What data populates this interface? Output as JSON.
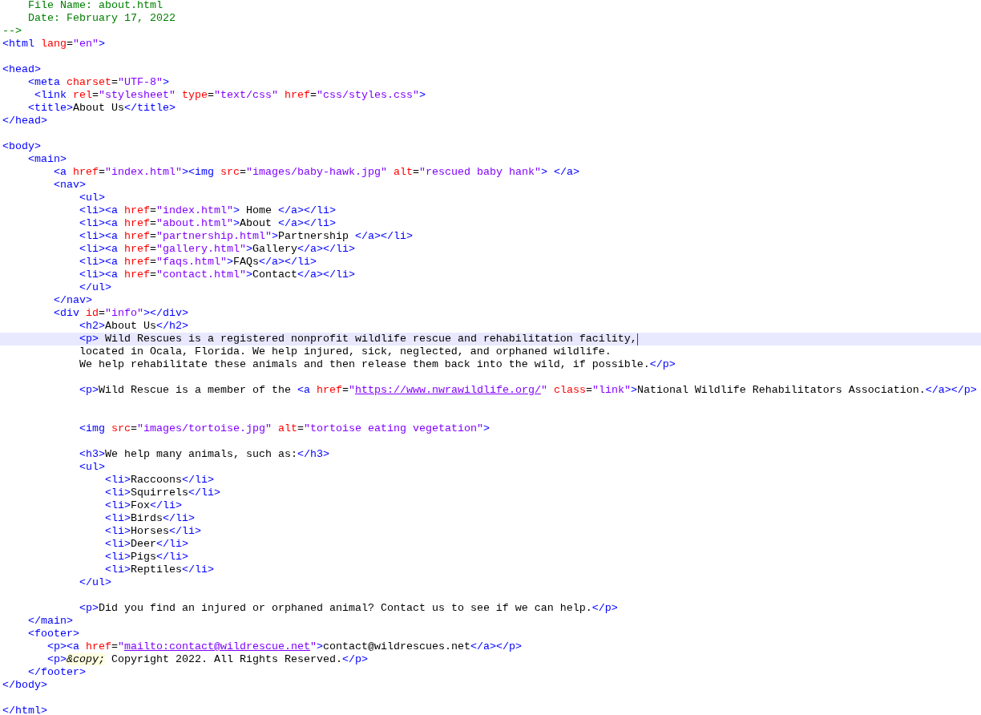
{
  "editor": {
    "lines": [
      {
        "kind": "code",
        "selected": false,
        "tokens": [
          {
            "kind": "comment",
            "text": "    File Name: about.html"
          }
        ]
      },
      {
        "kind": "code",
        "selected": false,
        "tokens": [
          {
            "kind": "comment",
            "text": "    Date: February 17, 2022"
          }
        ]
      },
      {
        "kind": "code",
        "selected": false,
        "tokens": [
          {
            "kind": "comment",
            "text": "-->"
          }
        ]
      },
      {
        "kind": "code",
        "selected": false,
        "tokens": [
          {
            "kind": "tag",
            "text": "<html "
          },
          {
            "kind": "attr",
            "text": "lang"
          },
          {
            "kind": "text",
            "text": "="
          },
          {
            "kind": "value",
            "text": "\"en\""
          },
          {
            "kind": "tag",
            "text": ">"
          }
        ]
      },
      {
        "kind": "blank"
      },
      {
        "kind": "code",
        "selected": false,
        "tokens": [
          {
            "kind": "tag",
            "text": "<head>"
          }
        ]
      },
      {
        "kind": "code",
        "selected": false,
        "tokens": [
          {
            "kind": "tag",
            "text": "    <meta "
          },
          {
            "kind": "attr",
            "text": "charset"
          },
          {
            "kind": "text",
            "text": "="
          },
          {
            "kind": "value",
            "text": "\"UTF-8\""
          },
          {
            "kind": "tag",
            "text": ">"
          }
        ]
      },
      {
        "kind": "code",
        "selected": false,
        "tokens": [
          {
            "kind": "tag",
            "text": "     <link "
          },
          {
            "kind": "attr",
            "text": "rel"
          },
          {
            "kind": "text",
            "text": "="
          },
          {
            "kind": "value",
            "text": "\"stylesheet\" "
          },
          {
            "kind": "attr",
            "text": "type"
          },
          {
            "kind": "text",
            "text": "="
          },
          {
            "kind": "value",
            "text": "\"text/css\" "
          },
          {
            "kind": "attr",
            "text": "href"
          },
          {
            "kind": "text",
            "text": "="
          },
          {
            "kind": "value",
            "text": "\"css/styles.css\""
          },
          {
            "kind": "tag",
            "text": ">"
          }
        ]
      },
      {
        "kind": "code",
        "selected": false,
        "tokens": [
          {
            "kind": "tag",
            "text": "    <title>"
          },
          {
            "kind": "text",
            "text": "About Us"
          },
          {
            "kind": "tag",
            "text": "</title>"
          }
        ]
      },
      {
        "kind": "code",
        "selected": false,
        "tokens": [
          {
            "kind": "tag",
            "text": "</head>"
          }
        ]
      },
      {
        "kind": "blank"
      },
      {
        "kind": "code",
        "selected": false,
        "tokens": [
          {
            "kind": "tag",
            "text": "<body>"
          }
        ]
      },
      {
        "kind": "code",
        "selected": false,
        "tokens": [
          {
            "kind": "tag",
            "text": "    <main>"
          }
        ]
      },
      {
        "kind": "code",
        "selected": false,
        "tokens": [
          {
            "kind": "tag",
            "text": "        <a "
          },
          {
            "kind": "attr",
            "text": "href"
          },
          {
            "kind": "text",
            "text": "="
          },
          {
            "kind": "value",
            "text": "\"index.html\""
          },
          {
            "kind": "tag",
            "text": "><img "
          },
          {
            "kind": "attr",
            "text": "src"
          },
          {
            "kind": "text",
            "text": "="
          },
          {
            "kind": "value",
            "text": "\"images/baby-hawk.jpg\" "
          },
          {
            "kind": "attr",
            "text": "alt"
          },
          {
            "kind": "text",
            "text": "="
          },
          {
            "kind": "value",
            "text": "\"rescued baby hank\""
          },
          {
            "kind": "tag",
            "text": "> </a>"
          }
        ]
      },
      {
        "kind": "code",
        "selected": false,
        "tokens": [
          {
            "kind": "tag",
            "text": "        <nav>"
          }
        ]
      },
      {
        "kind": "code",
        "selected": false,
        "tokens": [
          {
            "kind": "tag",
            "text": "            <ul>"
          }
        ]
      },
      {
        "kind": "code",
        "selected": false,
        "tokens": [
          {
            "kind": "tag",
            "text": "            <li><a "
          },
          {
            "kind": "attr",
            "text": "href"
          },
          {
            "kind": "text",
            "text": "="
          },
          {
            "kind": "value",
            "text": "\"index.html\""
          },
          {
            "kind": "tag",
            "text": ">"
          },
          {
            "kind": "text",
            "text": " Home "
          },
          {
            "kind": "tag",
            "text": "</a></li>"
          }
        ]
      },
      {
        "kind": "code",
        "selected": false,
        "tokens": [
          {
            "kind": "tag",
            "text": "            <li><a "
          },
          {
            "kind": "attr",
            "text": "href"
          },
          {
            "kind": "text",
            "text": "="
          },
          {
            "kind": "value",
            "text": "\"about.html\""
          },
          {
            "kind": "tag",
            "text": ">"
          },
          {
            "kind": "text",
            "text": "About "
          },
          {
            "kind": "tag",
            "text": "</a></li>"
          }
        ]
      },
      {
        "kind": "code",
        "selected": false,
        "tokens": [
          {
            "kind": "tag",
            "text": "            <li><a "
          },
          {
            "kind": "attr",
            "text": "href"
          },
          {
            "kind": "text",
            "text": "="
          },
          {
            "kind": "value",
            "text": "\"partnership.html\""
          },
          {
            "kind": "tag",
            "text": ">"
          },
          {
            "kind": "text",
            "text": "Partnership "
          },
          {
            "kind": "tag",
            "text": "</a></li>"
          }
        ]
      },
      {
        "kind": "code",
        "selected": false,
        "tokens": [
          {
            "kind": "tag",
            "text": "            <li><a "
          },
          {
            "kind": "attr",
            "text": "href"
          },
          {
            "kind": "text",
            "text": "="
          },
          {
            "kind": "value",
            "text": "\"gallery.html\""
          },
          {
            "kind": "tag",
            "text": ">"
          },
          {
            "kind": "text",
            "text": "Gallery"
          },
          {
            "kind": "tag",
            "text": "</a></li>"
          }
        ]
      },
      {
        "kind": "code",
        "selected": false,
        "tokens": [
          {
            "kind": "tag",
            "text": "            <li><a "
          },
          {
            "kind": "attr",
            "text": "href"
          },
          {
            "kind": "text",
            "text": "="
          },
          {
            "kind": "value",
            "text": "\"faqs.html\""
          },
          {
            "kind": "tag",
            "text": ">"
          },
          {
            "kind": "text",
            "text": "FAQs"
          },
          {
            "kind": "tag",
            "text": "</a></li>"
          }
        ]
      },
      {
        "kind": "code",
        "selected": false,
        "tokens": [
          {
            "kind": "tag",
            "text": "            <li><a "
          },
          {
            "kind": "attr",
            "text": "href"
          },
          {
            "kind": "text",
            "text": "="
          },
          {
            "kind": "value",
            "text": "\"contact.html\""
          },
          {
            "kind": "tag",
            "text": ">"
          },
          {
            "kind": "text",
            "text": "Contact"
          },
          {
            "kind": "tag",
            "text": "</a></li>"
          }
        ]
      },
      {
        "kind": "code",
        "selected": false,
        "tokens": [
          {
            "kind": "tag",
            "text": "            </ul>"
          }
        ]
      },
      {
        "kind": "code",
        "selected": false,
        "tokens": [
          {
            "kind": "tag",
            "text": "        </nav>"
          }
        ]
      },
      {
        "kind": "code",
        "selected": false,
        "tokens": [
          {
            "kind": "tag",
            "text": "        <div "
          },
          {
            "kind": "attr",
            "text": "id"
          },
          {
            "kind": "text",
            "text": "="
          },
          {
            "kind": "value",
            "text": "\"info\""
          },
          {
            "kind": "tag",
            "text": "></div>"
          }
        ]
      },
      {
        "kind": "code",
        "selected": false,
        "tokens": [
          {
            "kind": "tag",
            "text": "            <h2>"
          },
          {
            "kind": "text",
            "text": "About Us"
          },
          {
            "kind": "tag",
            "text": "</h2>"
          }
        ]
      },
      {
        "kind": "code",
        "selected": true,
        "tokens": [
          {
            "kind": "tag",
            "text": "            <p>"
          },
          {
            "kind": "text",
            "text": " Wild Rescues is a registered nonprofit wildlife rescue and rehabilitation facility,"
          }
        ]
      },
      {
        "kind": "code",
        "selected": false,
        "tokens": [
          {
            "kind": "text",
            "text": "            located in Ocala, Florida. We help injured, sick, neglected, and orphaned wildlife."
          }
        ]
      },
      {
        "kind": "code",
        "selected": false,
        "tokens": [
          {
            "kind": "text",
            "text": "            We help rehabilitate these animals and then release them back into the wild, if possible."
          },
          {
            "kind": "tag",
            "text": "</p>"
          }
        ]
      },
      {
        "kind": "blank"
      },
      {
        "kind": "code",
        "selected": false,
        "tokens": [
          {
            "kind": "tag",
            "text": "            <p>"
          },
          {
            "kind": "text",
            "text": "Wild Rescue is a member of the "
          },
          {
            "kind": "tag",
            "text": "<a "
          },
          {
            "kind": "attr",
            "text": "href"
          },
          {
            "kind": "text",
            "text": "="
          },
          {
            "kind": "value",
            "text": "\""
          },
          {
            "kind": "url",
            "text": "https://www.nwrawildlife.org/"
          },
          {
            "kind": "value",
            "text": "\" "
          },
          {
            "kind": "attr",
            "text": "class"
          },
          {
            "kind": "text",
            "text": "="
          },
          {
            "kind": "value",
            "text": "\"link\""
          },
          {
            "kind": "tag",
            "text": ">"
          },
          {
            "kind": "text",
            "text": "National Wildlife Rehabilitators Association."
          },
          {
            "kind": "tag",
            "text": "</a></p>"
          }
        ]
      },
      {
        "kind": "blank"
      },
      {
        "kind": "blank"
      },
      {
        "kind": "code",
        "selected": false,
        "tokens": [
          {
            "kind": "tag",
            "text": "            <img "
          },
          {
            "kind": "attr",
            "text": "src"
          },
          {
            "kind": "text",
            "text": "="
          },
          {
            "kind": "value",
            "text": "\"images/tortoise.jpg\" "
          },
          {
            "kind": "attr",
            "text": "alt"
          },
          {
            "kind": "text",
            "text": "="
          },
          {
            "kind": "value",
            "text": "\"tortoise eating vegetation\""
          },
          {
            "kind": "tag",
            "text": ">"
          }
        ]
      },
      {
        "kind": "blank"
      },
      {
        "kind": "code",
        "selected": false,
        "tokens": [
          {
            "kind": "tag",
            "text": "            <h3>"
          },
          {
            "kind": "text",
            "text": "We help many animals, such as:"
          },
          {
            "kind": "tag",
            "text": "</h3>"
          }
        ]
      },
      {
        "kind": "code",
        "selected": false,
        "tokens": [
          {
            "kind": "tag",
            "text": "            <ul>"
          }
        ]
      },
      {
        "kind": "code",
        "selected": false,
        "tokens": [
          {
            "kind": "tag",
            "text": "                <li>"
          },
          {
            "kind": "text",
            "text": "Raccoons"
          },
          {
            "kind": "tag",
            "text": "</li>"
          }
        ]
      },
      {
        "kind": "code",
        "selected": false,
        "tokens": [
          {
            "kind": "tag",
            "text": "                <li>"
          },
          {
            "kind": "text",
            "text": "Squirrels"
          },
          {
            "kind": "tag",
            "text": "</li>"
          }
        ]
      },
      {
        "kind": "code",
        "selected": false,
        "tokens": [
          {
            "kind": "tag",
            "text": "                <li>"
          },
          {
            "kind": "text",
            "text": "Fox"
          },
          {
            "kind": "tag",
            "text": "</li>"
          }
        ]
      },
      {
        "kind": "code",
        "selected": false,
        "tokens": [
          {
            "kind": "tag",
            "text": "                <li>"
          },
          {
            "kind": "text",
            "text": "Birds"
          },
          {
            "kind": "tag",
            "text": "</li>"
          }
        ]
      },
      {
        "kind": "code",
        "selected": false,
        "tokens": [
          {
            "kind": "tag",
            "text": "                <li>"
          },
          {
            "kind": "text",
            "text": "Horses"
          },
          {
            "kind": "tag",
            "text": "</li>"
          }
        ]
      },
      {
        "kind": "code",
        "selected": false,
        "tokens": [
          {
            "kind": "tag",
            "text": "                <li>"
          },
          {
            "kind": "text",
            "text": "Deer"
          },
          {
            "kind": "tag",
            "text": "</li>"
          }
        ]
      },
      {
        "kind": "code",
        "selected": false,
        "tokens": [
          {
            "kind": "tag",
            "text": "                <li>"
          },
          {
            "kind": "text",
            "text": "Pigs"
          },
          {
            "kind": "tag",
            "text": "</li>"
          }
        ]
      },
      {
        "kind": "code",
        "selected": false,
        "tokens": [
          {
            "kind": "tag",
            "text": "                <li>"
          },
          {
            "kind": "text",
            "text": "Reptiles"
          },
          {
            "kind": "tag",
            "text": "</li>"
          }
        ]
      },
      {
        "kind": "code",
        "selected": false,
        "tokens": [
          {
            "kind": "tag",
            "text": "            </ul>"
          }
        ]
      },
      {
        "kind": "blank"
      },
      {
        "kind": "code",
        "selected": false,
        "tokens": [
          {
            "kind": "tag",
            "text": "            <p>"
          },
          {
            "kind": "text",
            "text": "Did you find an injured or orphaned animal? Contact us to see if we can help."
          },
          {
            "kind": "tag",
            "text": "</p>"
          }
        ]
      },
      {
        "kind": "code",
        "selected": false,
        "tokens": [
          {
            "kind": "tag",
            "text": "    </main>"
          }
        ]
      },
      {
        "kind": "code",
        "selected": false,
        "tokens": [
          {
            "kind": "tag",
            "text": "    <footer>"
          }
        ]
      },
      {
        "kind": "code",
        "selected": false,
        "tokens": [
          {
            "kind": "tag",
            "text": "       <p><a "
          },
          {
            "kind": "attr",
            "text": "href"
          },
          {
            "kind": "text",
            "text": "="
          },
          {
            "kind": "value",
            "text": "\""
          },
          {
            "kind": "url",
            "text": "mailto:contact@wildrescue.net"
          },
          {
            "kind": "value",
            "text": "\""
          },
          {
            "kind": "tag",
            "text": ">"
          },
          {
            "kind": "text",
            "text": "contact@wildrescues.net"
          },
          {
            "kind": "tag",
            "text": "</a></p>"
          }
        ]
      },
      {
        "kind": "code",
        "selected": false,
        "tokens": [
          {
            "kind": "tag",
            "text": "       <p>"
          },
          {
            "kind": "entity",
            "text": "&copy;"
          },
          {
            "kind": "text",
            "text": " Copyright 2022. All Rights Reserved."
          },
          {
            "kind": "tag",
            "text": "</p>"
          }
        ]
      },
      {
        "kind": "code",
        "selected": false,
        "tokens": [
          {
            "kind": "tag",
            "text": "    </footer>"
          }
        ]
      },
      {
        "kind": "code",
        "selected": false,
        "tokens": [
          {
            "kind": "tag",
            "text": "</body>"
          }
        ]
      },
      {
        "kind": "blank"
      },
      {
        "kind": "code",
        "selected": false,
        "tokens": [
          {
            "kind": "tag",
            "text": "</html>"
          }
        ]
      }
    ]
  }
}
